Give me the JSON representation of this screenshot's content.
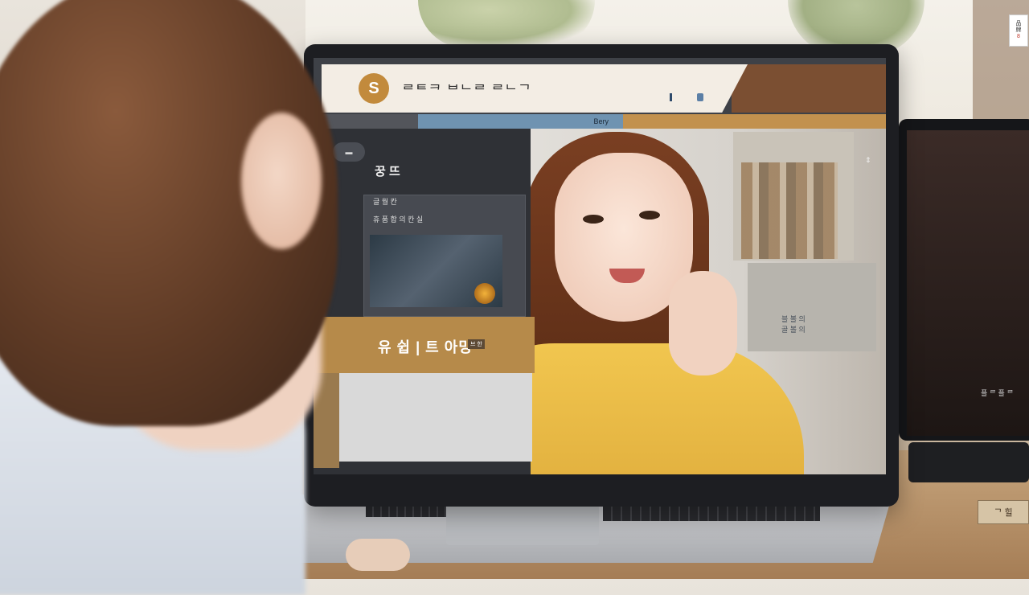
{
  "watermark": {
    "line1": "品",
    "line2": "牌",
    "line3": "8"
  },
  "site": {
    "logo_text": "S",
    "title": "ᄅᄐᄏ ᄇᄂᄅ ᄅᄂᄀ",
    "header_icons": "• • •",
    "subnav_label": "Bery"
  },
  "left_panel": {
    "menu_chip": "▬",
    "heading": "꿍 뜨",
    "card_line_1": "글 월 칸",
    "card_line_2": "휴 품 합 의 칸 실"
  },
  "promo": {
    "text": "유 쉽 | 트 아밍",
    "small_tag": "브 한"
  },
  "photo": {
    "screen_label": "블 볼 의\n골 볼 의",
    "scroll_icon": "⇕"
  },
  "monitor_right": {
    "text": "플 ᄅ 플 ᄅ"
  },
  "nameplate": {
    "text": "ᄀ 힐"
  },
  "colors": {
    "header_bg": "#f3ede4",
    "accent_gold": "#c28a3c",
    "subnav_blue": "#6f93b1",
    "sweater": "#f1c64f"
  }
}
